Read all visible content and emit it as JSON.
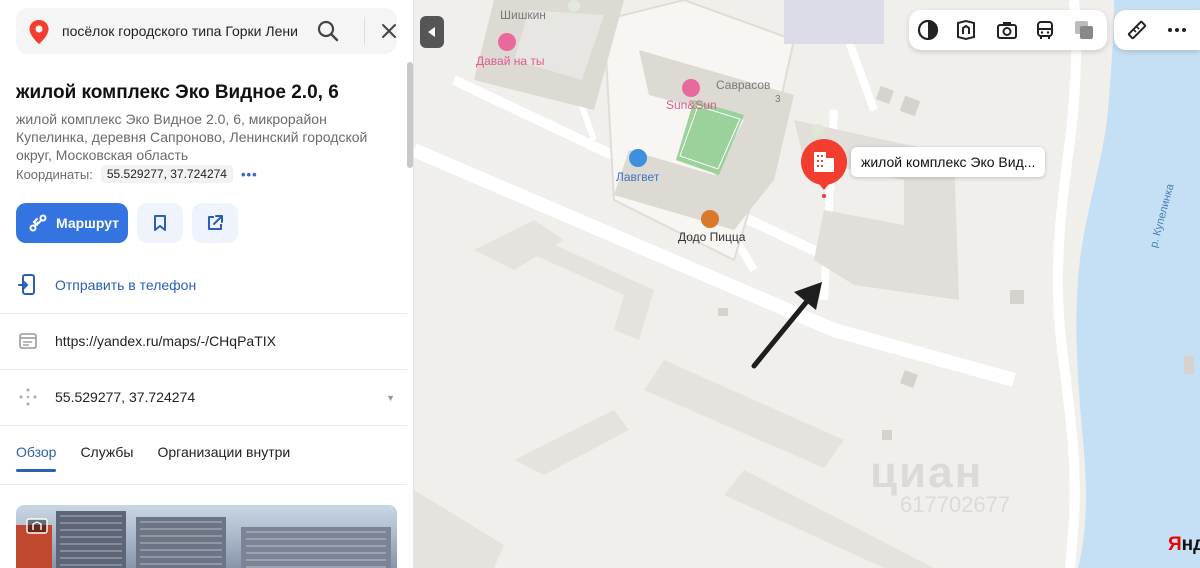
{
  "search": {
    "value": "посёлок городского типа Горки Лени",
    "search_icon": "search-icon",
    "close_icon": "close-icon"
  },
  "place": {
    "title": "жилой комплекс Эко Видное 2.0, 6",
    "address": "жилой комплекс Эко Видное 2.0, 6, микрорайон Купелинка, деревня Сапроново, Ленинский городской округ, Московская область",
    "coords_label": "Координаты:",
    "coords_value": "55.529277, 37.724274",
    "coords_more": "•••"
  },
  "actions": {
    "route_label": "Маршрут"
  },
  "rows": {
    "send_phone": "Отправить в телефон",
    "link": "https://yandex.ru/maps/-/CHqPaTIX",
    "coords": "55.529277, 37.724274"
  },
  "tabs": [
    {
      "label": "Обзор",
      "active": true
    },
    {
      "label": "Службы",
      "active": false
    },
    {
      "label": "Организации внутри",
      "active": false
    }
  ],
  "map": {
    "pin_label": "жилой комплекс Эко Вид...",
    "labels": {
      "shishkin": "Шишкин",
      "davay": "Давай на ты",
      "savrasov": "Саврасов",
      "sunsun": "Sun&Sun",
      "lavvet": "Лавгвет",
      "dodo": "Додо Пицца",
      "house_num": "3",
      "river": "р. Купелинка"
    },
    "watermark": "циан",
    "watermark_phone": "617702677",
    "logo_black": "Янд",
    "colors": {
      "accent": "#3374e0",
      "pin": "#f23d2f",
      "water": "#c5dff4"
    }
  }
}
